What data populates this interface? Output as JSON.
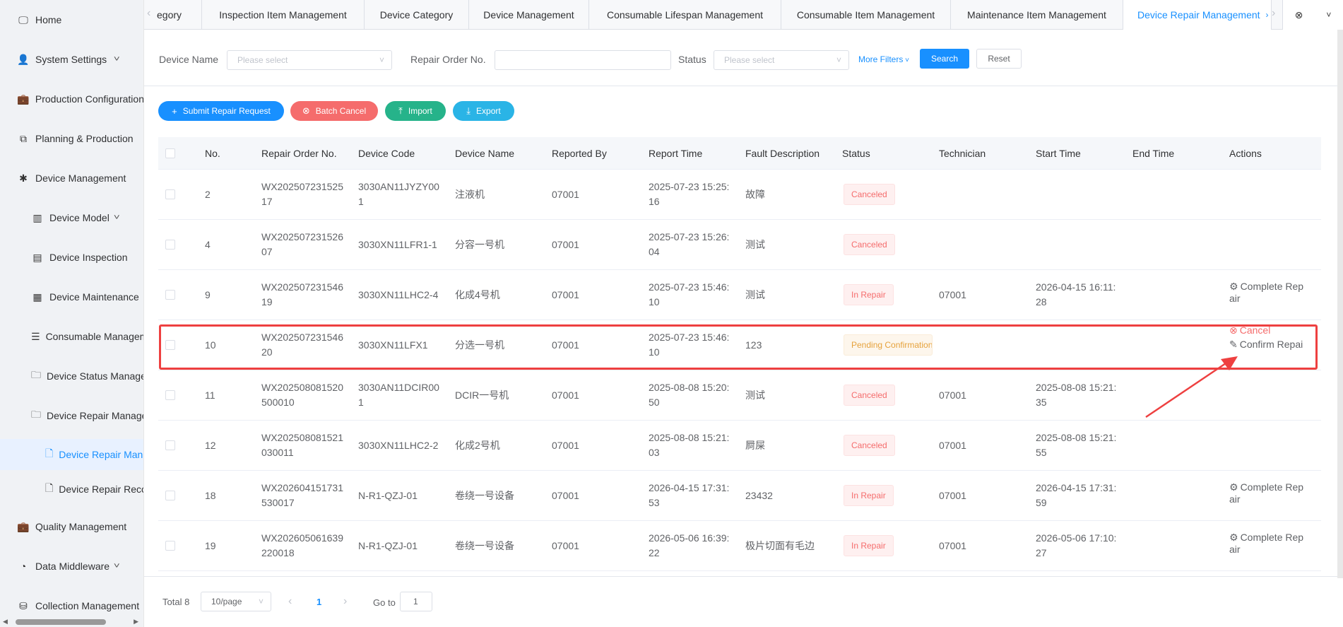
{
  "sidebar": {
    "items": [
      {
        "label": "Home",
        "icon": "monitor-icon"
      },
      {
        "label": "System Settings",
        "icon": "user-settings-icon"
      },
      {
        "label": "Production Configuration",
        "icon": "briefcase-icon"
      },
      {
        "label": "Planning & Production",
        "icon": "flow-icon"
      },
      {
        "label": "Device Management",
        "icon": "asterisk-icon"
      },
      {
        "label": "Device Model",
        "icon": "columns-icon"
      },
      {
        "label": "Device Inspection",
        "icon": "inspection-icon"
      },
      {
        "label": "Device Maintenance",
        "icon": "maintenance-icon"
      },
      {
        "label": "Consumable Management",
        "icon": "list-icon"
      },
      {
        "label": "Device Status Management",
        "icon": "folder-icon"
      },
      {
        "label": "Device Repair Management",
        "icon": "folder-icon"
      },
      {
        "label": "Device Repair Management",
        "icon": "file-icon"
      },
      {
        "label": "Device Repair Records",
        "icon": "file-icon"
      },
      {
        "label": "Quality Management",
        "icon": "briefcase-icon"
      },
      {
        "label": "Data Middleware",
        "icon": "pie-icon"
      },
      {
        "label": "Collection Management",
        "icon": "database-icon"
      }
    ]
  },
  "tabs": [
    "egory",
    "Inspection Item Management",
    "Device Category",
    "Device Management",
    "Consumable Lifespan Management",
    "Consumable Item Management",
    "Maintenance Item Management",
    "Device Repair Management"
  ],
  "filter": {
    "device_name_label": "Device Name",
    "device_name_placeholder": "Please select",
    "order_no_label": "Repair Order No.",
    "order_no_value": "",
    "status_label": "Status",
    "status_placeholder": "Please select",
    "more_filters": "More Filters",
    "search": "Search",
    "reset": "Reset"
  },
  "toolbar": {
    "submit": "Submit Repair Request",
    "batch_cancel": "Batch Cancel",
    "import": "Import",
    "export": "Export"
  },
  "table": {
    "columns": [
      "No.",
      "Repair Order No.",
      "Device Code",
      "Device Name",
      "Reported By",
      "Report Time",
      "Fault Description",
      "Status",
      "Technician",
      "Start Time",
      "End Time",
      "Actions"
    ],
    "rows": [
      {
        "no": "2",
        "order_a": "WX202507231525",
        "order_b": "17",
        "code_a": "3030AN11JYZY00",
        "code_b": "1",
        "name": "注液机",
        "reporter": "07001",
        "time_a": "2025-07-23 15:25:",
        "time_b": "16",
        "fault": "故障",
        "status": "Canceled",
        "tech": "",
        "start_a": "",
        "start_b": "",
        "end": "",
        "actions": []
      },
      {
        "no": "4",
        "order_a": "WX202507231526",
        "order_b": "07",
        "code_a": "3030XN11LFR1-1",
        "code_b": "",
        "name": "分容一号机",
        "reporter": "07001",
        "time_a": "2025-07-23 15:26:",
        "time_b": "04",
        "fault": "测试",
        "status": "Canceled",
        "tech": "",
        "start_a": "",
        "start_b": "",
        "end": "",
        "actions": []
      },
      {
        "no": "9",
        "order_a": "WX202507231546",
        "order_b": "19",
        "code_a": "3030XN11LHC2-4",
        "code_b": "",
        "name": "化成4号机",
        "reporter": "07001",
        "time_a": "2025-07-23 15:46:",
        "time_b": "10",
        "fault": "测试",
        "status": "In Repair",
        "tech": "07001",
        "start_a": "2026-04-15 16:11:",
        "start_b": "28",
        "end": "",
        "actions": [
          "Complete Rep",
          "air"
        ]
      },
      {
        "no": "10",
        "order_a": "WX202507231546",
        "order_b": "20",
        "code_a": "3030XN11LFX1",
        "code_b": "",
        "name": "分选一号机",
        "reporter": "07001",
        "time_a": "2025-07-23 15:46:",
        "time_b": "10",
        "fault": "123",
        "status": "Pending Confirmation",
        "tech": "",
        "start_a": "",
        "start_b": "",
        "end": "",
        "actions": [
          "Cancel",
          "Confirm Repai"
        ]
      },
      {
        "no": "11",
        "order_a": "WX202508081520",
        "order_b": "500010",
        "code_a": "3030AN11DCIR00",
        "code_b": "1",
        "name": "DCIR一号机",
        "reporter": "07001",
        "time_a": "2025-08-08 15:20:",
        "time_b": "50",
        "fault": "测试",
        "status": "Canceled",
        "tech": "07001",
        "start_a": "2025-08-08 15:21:",
        "start_b": "35",
        "end": "",
        "actions": []
      },
      {
        "no": "12",
        "order_a": "WX202508081521",
        "order_b": "030011",
        "code_a": "3030XN11LHC2-2",
        "code_b": "",
        "name": "化成2号机",
        "reporter": "07001",
        "time_a": "2025-08-08 15:21:",
        "time_b": "03",
        "fault": "屙屎",
        "status": "Canceled",
        "tech": "07001",
        "start_a": "2025-08-08 15:21:",
        "start_b": "55",
        "end": "",
        "actions": []
      },
      {
        "no": "18",
        "order_a": "WX202604151731",
        "order_b": "530017",
        "code_a": "N-R1-QZJ-01",
        "code_b": "",
        "name": "卷绕一号设备",
        "reporter": "07001",
        "time_a": "2026-04-15 17:31:",
        "time_b": "53",
        "fault": "23432",
        "status": "In Repair",
        "tech": "07001",
        "start_a": "2026-04-15 17:31:",
        "start_b": "59",
        "end": "",
        "actions": [
          "Complete Rep",
          "air"
        ]
      },
      {
        "no": "19",
        "order_a": "WX202605061639",
        "order_b": "220018",
        "code_a": "N-R1-QZJ-01",
        "code_b": "",
        "name": "卷绕一号设备",
        "reporter": "07001",
        "time_a": "2026-05-06 16:39:",
        "time_b": "22",
        "fault": "极片切面有毛边",
        "status": "In Repair",
        "tech": "07001",
        "start_a": "2026-05-06 17:10:",
        "start_b": "27",
        "end": "",
        "actions": [
          "Complete Rep",
          "air"
        ]
      }
    ]
  },
  "pagination": {
    "total": "Total 8",
    "page_size": "10/page",
    "current": "1",
    "goto_label": "Go to",
    "goto_value": "1"
  },
  "colors": {
    "primary": "#1890ff",
    "danger": "#f56c6c",
    "success": "#26b38a",
    "info": "#2ab4e6",
    "highlight": "#ee4040"
  }
}
